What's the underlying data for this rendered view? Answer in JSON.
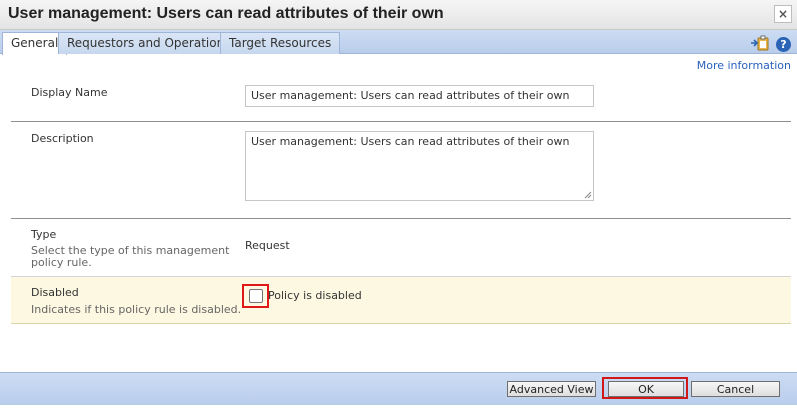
{
  "dialog": {
    "title": "User management: Users can read attributes of their own",
    "close_glyph": "×"
  },
  "tabs": [
    {
      "label": "General",
      "active": true
    },
    {
      "label": "Requestors and Operations",
      "active": false
    },
    {
      "label": "Target Resources",
      "active": false
    }
  ],
  "toolbar_icons": {
    "export_icon": "export-to-clipboard-icon",
    "help_glyph": "?"
  },
  "more_info": "More information",
  "fields": {
    "display_name": {
      "label": "Display Name",
      "value": "User management: Users can read attributes of their own"
    },
    "description": {
      "label": "Description",
      "value": "User management: Users can read attributes of their own"
    },
    "type": {
      "label": "Type",
      "sublabel": "Select the type of this management policy rule.",
      "value": "Request"
    },
    "disabled": {
      "label": "Disabled",
      "sublabel": "Indicates if this policy rule is disabled.",
      "checkbox_label": "Policy is disabled",
      "checked": false
    }
  },
  "footer": {
    "advanced_view": "Advanced View",
    "ok": "OK",
    "cancel": "Cancel"
  },
  "colors": {
    "tab_bar": "#c6d7ee",
    "highlight_row": "#fcf8e1",
    "annotation_red": "#e01818",
    "link": "#2a62bc"
  }
}
